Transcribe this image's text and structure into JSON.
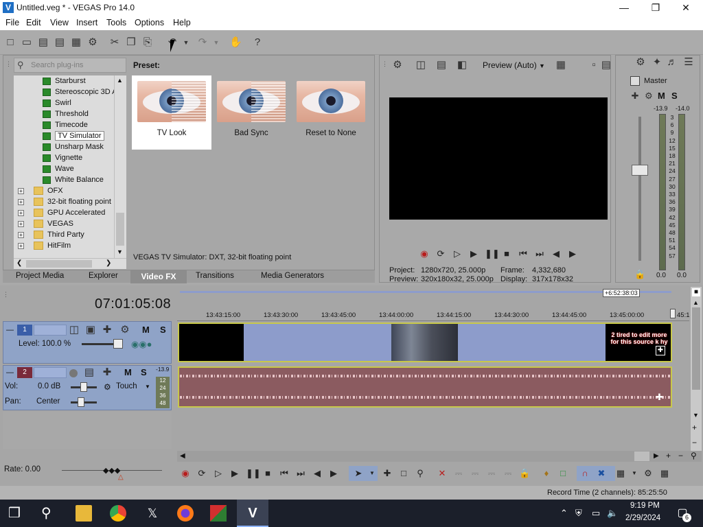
{
  "window": {
    "title": "Untitled.veg * - VEGAS Pro 14.0",
    "icon_letter": "V"
  },
  "menu": [
    "File",
    "Edit",
    "View",
    "Insert",
    "Tools",
    "Options",
    "Help"
  ],
  "plugins": {
    "search_placeholder": "Search plug-ins",
    "effects": [
      "Starburst",
      "Stereoscopic 3D A",
      "Swirl",
      "Threshold",
      "Timecode",
      "TV Simulator",
      "Unsharp Mask",
      "Vignette",
      "Wave",
      "White Balance"
    ],
    "selected": "TV Simulator",
    "folders": [
      "OFX",
      "32-bit floating point",
      "GPU Accelerated",
      "VEGAS",
      "Third Party",
      "HitFilm"
    ]
  },
  "presets": {
    "label": "Preset:",
    "items": [
      "TV Look",
      "Bad Sync",
      "Reset to None"
    ],
    "selected": "TV Look",
    "description": "VEGAS TV Simulator: DXT, 32-bit floating point"
  },
  "tabs": [
    "Project Media",
    "Explorer",
    "Video FX",
    "Transitions",
    "Media Generators"
  ],
  "active_tab": "Video FX",
  "preview": {
    "mode": "Preview (Auto)",
    "project_label": "Project:",
    "project_value": "1280x720, 25.000p",
    "preview_label": "Preview:",
    "preview_value": "320x180x32, 25.000p",
    "frame_label": "Frame:",
    "frame_value": "4,332,680",
    "display_label": "Display:",
    "display_value": "317x178x32"
  },
  "master": {
    "label": "Master",
    "peak_left": "-13.9",
    "peak_right": "-14.0",
    "scale": [
      "3",
      "6",
      "9",
      "12",
      "15",
      "18",
      "21",
      "24",
      "27",
      "30",
      "33",
      "36",
      "39",
      "42",
      "45",
      "48",
      "51",
      "54",
      "57"
    ],
    "bottom_left": "0.0",
    "bottom_right": "0.0"
  },
  "timeline": {
    "timecode": "07:01:05:08",
    "badge": "+6:52:38:03",
    "ticks": [
      "13:43:15:00",
      "13:43:30:00",
      "13:43:45:00",
      "13:44:00:00",
      "13:44:15:00",
      "13:44:30:00",
      "13:44:45:00",
      "13:45:00:00",
      "45:1"
    ],
    "video_track": {
      "number": "1",
      "level_label": "Level: 100.0 %",
      "m": "M",
      "s": "S"
    },
    "audio_track": {
      "number": "2",
      "vol_label": "Vol:",
      "vol_value": "0.0 dB",
      "pan_label": "Pan:",
      "pan_value": "Center",
      "mode": "Touch",
      "meter_peak": "-13.9",
      "meter_scale": [
        "12",
        "24",
        "36",
        "48"
      ],
      "m": "M",
      "s": "S"
    },
    "video_end_text": "2 tired to edit more for this source k hy"
  },
  "rate": "Rate: 0.00",
  "record_time": "Record Time (2 channels): 85:25:50",
  "clock": {
    "time": "9:19 PM",
    "date": "2/29/2024"
  },
  "notification_count": "6"
}
